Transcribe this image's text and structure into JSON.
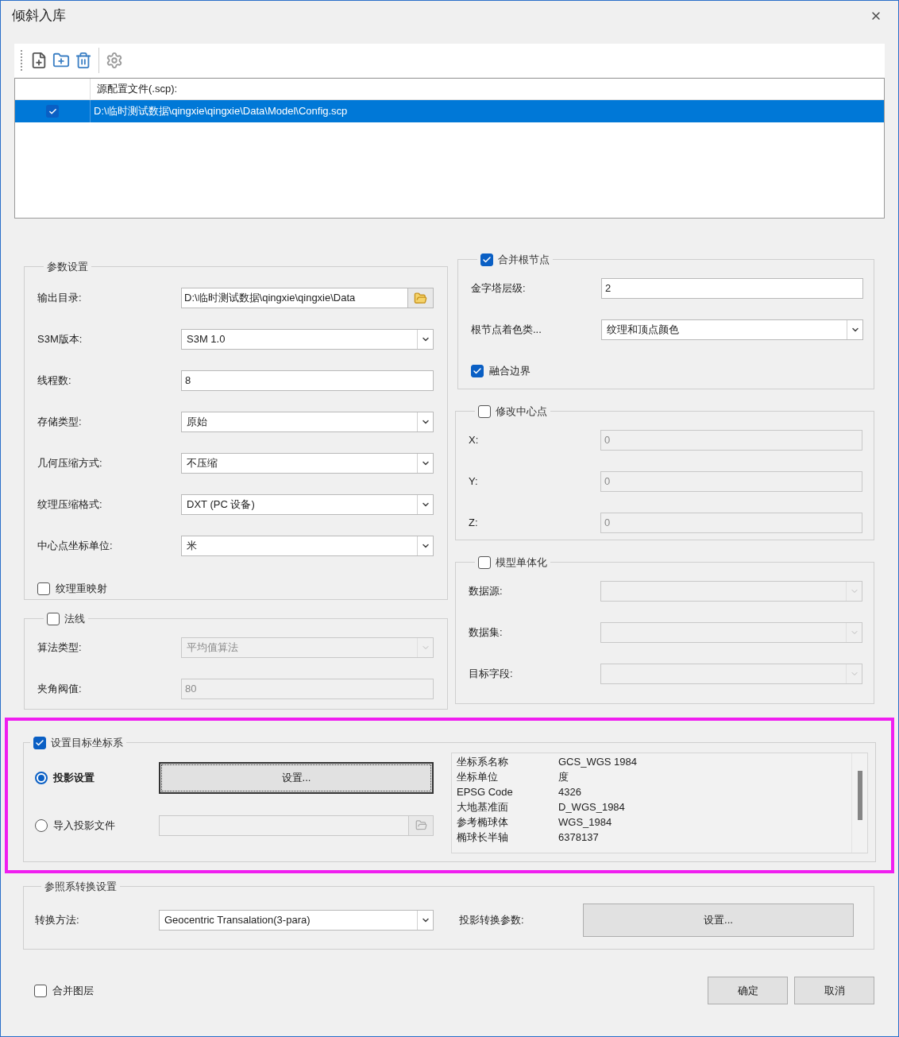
{
  "window": {
    "title": "倾斜入库"
  },
  "source_table": {
    "columns": [
      "源配置文件(.scp):"
    ],
    "rows": [
      {
        "checked": true,
        "selected": true,
        "path": "D:\\临时测试数据\\qingxie\\qingxie\\Data\\Model\\Config.scp"
      }
    ]
  },
  "params": {
    "title": "参数设置",
    "fields": [
      {
        "kind": "browse",
        "label": "输出目录:",
        "value": "D:\\临时测试数据\\qingxie\\qingxie\\Data"
      },
      {
        "kind": "dropdown",
        "label": "S3M版本:",
        "value": "S3M 1.0"
      },
      {
        "kind": "text",
        "label": "线程数:",
        "value": "8"
      },
      {
        "kind": "dropdown",
        "label": "存储类型:",
        "value": "原始"
      },
      {
        "kind": "dropdown",
        "label": "几何压缩方式:",
        "value": "不压缩"
      },
      {
        "kind": "dropdown",
        "label": "纹理压缩格式:",
        "value": "DXT (PC 设备)"
      },
      {
        "kind": "dropdown",
        "label": "中心点坐标单位:",
        "value": "米"
      }
    ],
    "texture_remap": {
      "label": "纹理重映射",
      "checked": false
    }
  },
  "normals": {
    "title": "法线",
    "checked": false,
    "fields": [
      {
        "kind": "dropdown",
        "label": "算法类型:",
        "value": "平均值算法",
        "disabled": true
      },
      {
        "kind": "text",
        "label": "夹角阀值:",
        "value": "80",
        "disabled": true
      }
    ]
  },
  "merge_root": {
    "title": "合并根节点",
    "checked": true,
    "fields": [
      {
        "kind": "text",
        "label": "金字塔层级:",
        "value": "2"
      },
      {
        "kind": "dropdown",
        "label": "根节点着色类...",
        "value": "纹理和顶点颜色"
      }
    ],
    "merge_border": {
      "label": "融合边界",
      "checked": true
    }
  },
  "center": {
    "title": "修改中心点",
    "checked": false,
    "fields": [
      {
        "kind": "text",
        "label": "X:",
        "value": "0",
        "disabled": true
      },
      {
        "kind": "text",
        "label": "Y:",
        "value": "0",
        "disabled": true
      },
      {
        "kind": "text",
        "label": "Z:",
        "value": "0",
        "disabled": true
      }
    ]
  },
  "singleton": {
    "title": "模型单体化",
    "checked": false,
    "fields": [
      {
        "kind": "dropdown",
        "label": "数据源:",
        "disabled": true
      },
      {
        "kind": "dropdown",
        "label": "数据集:",
        "disabled": true
      },
      {
        "kind": "dropdown",
        "label": "目标字段:",
        "disabled": true
      }
    ]
  },
  "target_crs": {
    "title": "设置目标坐标系",
    "checked": true,
    "options": [
      {
        "kind": "button",
        "label": "投影设置",
        "selected": true,
        "button": "设置..."
      },
      {
        "kind": "file",
        "label": "导入投影文件",
        "selected": false
      }
    ],
    "info": [
      {
        "key": "坐标系名称",
        "value": "GCS_WGS 1984"
      },
      {
        "key": "坐标单位",
        "value": "度"
      },
      {
        "key": "EPSG Code",
        "value": "4326"
      },
      {
        "key": "大地基准面",
        "value": "D_WGS_1984"
      },
      {
        "key": "参考椭球体",
        "value": "WGS_1984"
      },
      {
        "key": "椭球长半轴",
        "value": "6378137"
      }
    ]
  },
  "transform": {
    "title": "参照系转换设置",
    "method_label": "转换方法:",
    "method": "Geocentric Transalation(3-para)",
    "params_label": "投影转换参数:",
    "params_button": "设置..."
  },
  "merge_layers": {
    "label": "合并图层",
    "checked": false
  },
  "buttons": [
    "确定",
    "取消"
  ]
}
